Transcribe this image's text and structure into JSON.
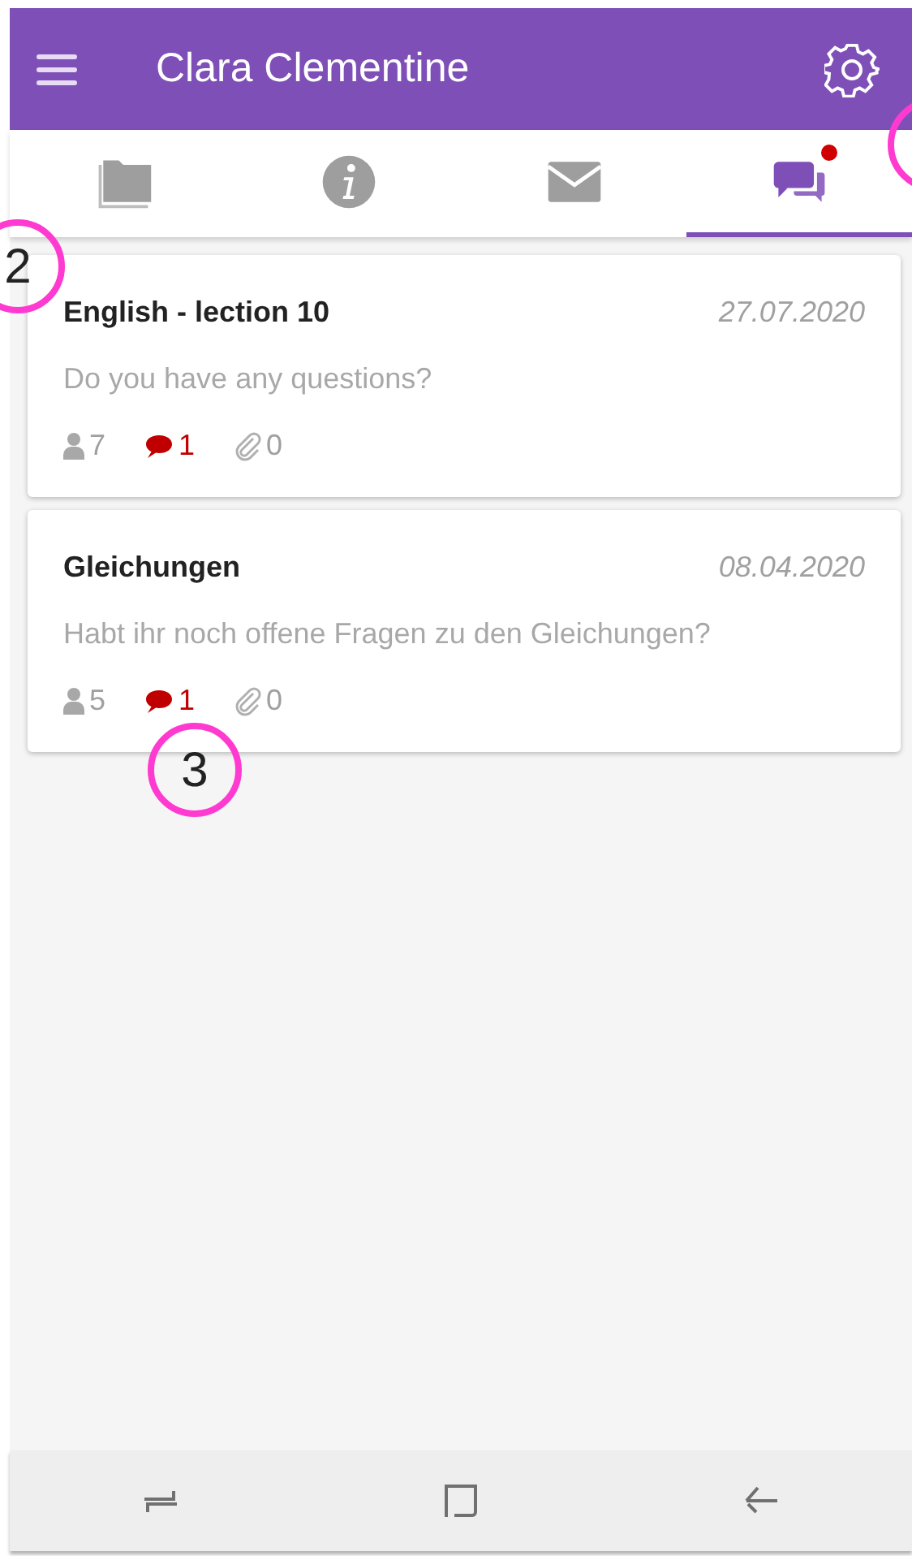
{
  "app_bar": {
    "title": "Clara Clementine"
  },
  "tabs": [
    {
      "kind": "folder",
      "selected": false,
      "unread": false
    },
    {
      "kind": "info",
      "selected": false,
      "unread": false
    },
    {
      "kind": "mail",
      "selected": false,
      "unread": false
    },
    {
      "kind": "chat",
      "selected": true,
      "unread": true
    }
  ],
  "threads": [
    {
      "title": "English - lection 10",
      "date": "27.07.2020",
      "preview": "Do you have any questions?",
      "participants": "7",
      "comments": "1",
      "attachments": "0"
    },
    {
      "title": "Gleichungen",
      "date": "08.04.2020",
      "preview": "Habt ihr noch offene Fragen zu den Gleichungen?",
      "participants": "5",
      "comments": "1",
      "attachments": "0"
    }
  ],
  "annotations": [
    {
      "kind": "cut"
    },
    {
      "kind": "numbered",
      "label": "2"
    },
    {
      "kind": "numbered",
      "label": "3"
    }
  ]
}
